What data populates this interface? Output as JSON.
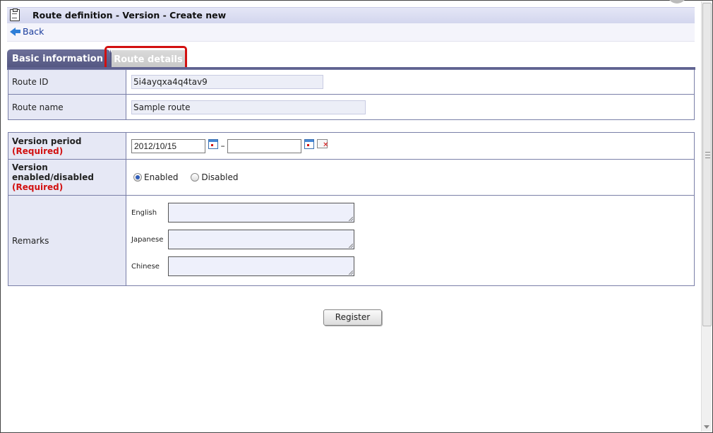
{
  "header": {
    "title": "Route definition - Version - Create new",
    "back_label": "Back"
  },
  "tabs": [
    {
      "label": "Basic information",
      "active": true
    },
    {
      "label": "Route details",
      "active": false,
      "highlighted": true
    }
  ],
  "route": {
    "id_label": "Route ID",
    "id_value": "5i4ayqxa4q4tav9",
    "name_label": "Route name",
    "name_value": "Sample route"
  },
  "version": {
    "period_label": "Version period",
    "required_text": "(Required)",
    "start_date": "2012/10/15",
    "end_date": "",
    "range_separator": "–",
    "enabled_label_line1": "Version",
    "enabled_label_line2": "enabled/disabled",
    "enabled_option": "Enabled",
    "disabled_option": "Disabled",
    "selected": "Enabled"
  },
  "remarks": {
    "label": "Remarks",
    "languages": [
      "English",
      "Japanese",
      "Chinese"
    ],
    "values": [
      "",
      "",
      ""
    ]
  },
  "actions": {
    "register_label": "Register"
  },
  "colors": {
    "tab_active": "#5f6290",
    "label_bg": "#e6e8f5",
    "required": "#d21010",
    "highlight": "#d21010"
  }
}
